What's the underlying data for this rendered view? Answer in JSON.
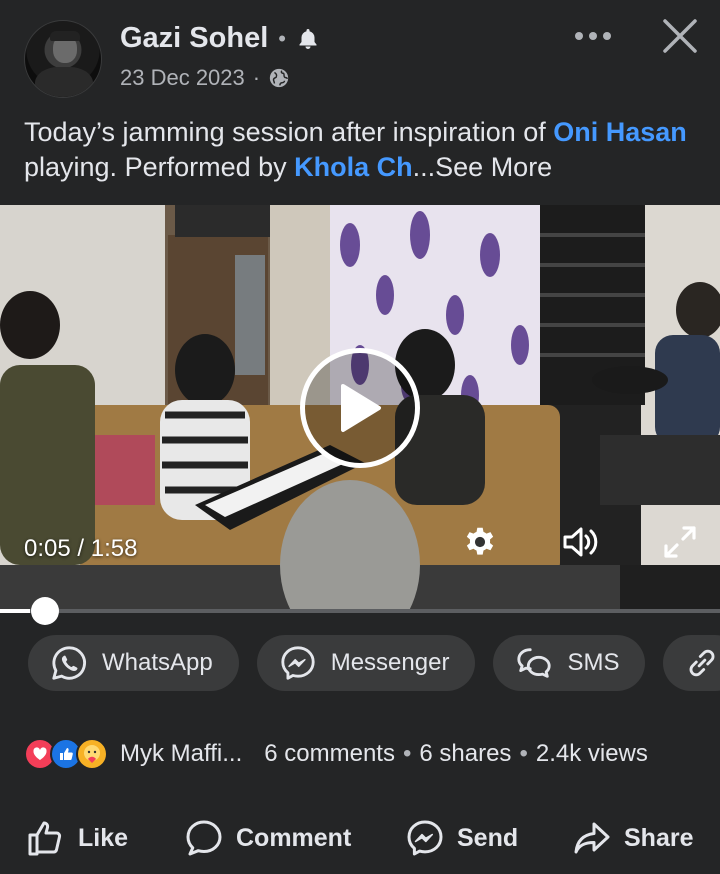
{
  "post": {
    "author": "Gazi Sohel",
    "separator": "•",
    "date": "23 Dec 2023",
    "date_separator": "·",
    "caption": {
      "part1": "Today’s jamming session after inspiration of ",
      "mention1": "Oni Hasan",
      "part2": " playing. Performed by ",
      "mention2": "Khola Ch",
      "see_more": "...See More"
    }
  },
  "video": {
    "current_time": "0:05",
    "divider": " / ",
    "duration": "1:58",
    "progress_fraction": 0.042
  },
  "share_options": [
    {
      "label": "WhatsApp",
      "icon": "whatsapp-icon"
    },
    {
      "label": "Messenger",
      "icon": "messenger-icon"
    },
    {
      "label": "SMS",
      "icon": "sms-icon"
    },
    {
      "label": "",
      "icon": "link-icon"
    }
  ],
  "stats": {
    "reactions": [
      "love",
      "like",
      "care"
    ],
    "reactor": "Myk Maffi...",
    "comments": "6 comments",
    "dot": "•",
    "shares": "6 shares",
    "views": "2.4k views"
  },
  "actions": {
    "like": "Like",
    "comment": "Comment",
    "send": "Send",
    "share": "Share"
  },
  "colors": {
    "background": "#242526",
    "chip": "#3a3b3c",
    "mention": "#4599ff",
    "text": "#e4e6eb",
    "muted": "#b0b3b8"
  }
}
